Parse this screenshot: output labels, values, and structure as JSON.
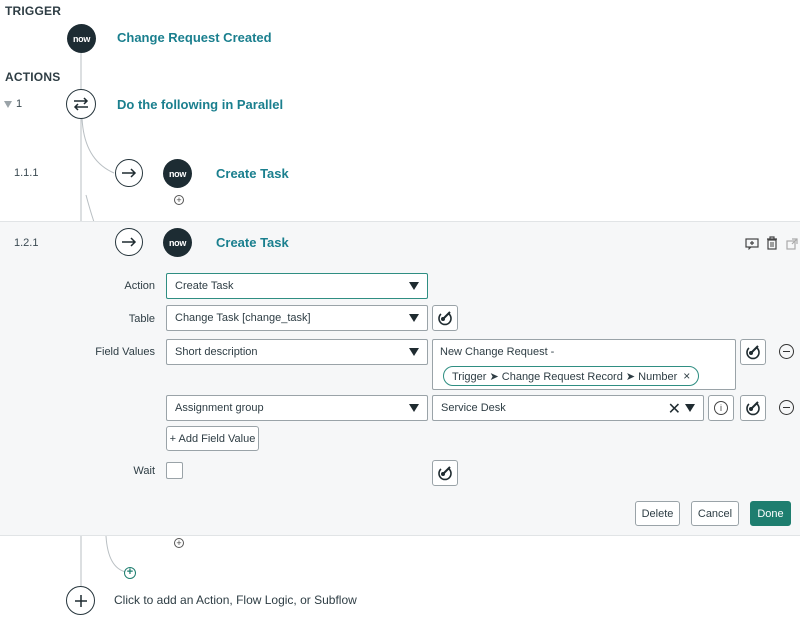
{
  "trigger": {
    "section_label": "TRIGGER",
    "badge": "now",
    "title": "Change Request Created"
  },
  "actions": {
    "section_label": "ACTIONS",
    "parallel": {
      "number": "1",
      "title": "Do the following in Parallel"
    },
    "step1": {
      "number": "1.1.1",
      "badge": "now",
      "title": "Create Task"
    },
    "step2": {
      "number": "1.2.1",
      "badge": "now",
      "title": "Create Task",
      "form": {
        "action_label": "Action",
        "action_value": "Create Task",
        "table_label": "Table",
        "table_value": "Change Task [change_task]",
        "field_values_label": "Field Values",
        "field1_name": "Short description",
        "field1_text": "New Change Request -",
        "field1_pill": "Trigger ➤ Change Request Record ➤ Number",
        "field2_name": "Assignment group",
        "field2_value": "Service Desk",
        "add_field_value": "+ Add Field Value",
        "wait_label": "Wait"
      },
      "buttons": {
        "delete": "Delete",
        "cancel": "Cancel",
        "done": "Done"
      }
    }
  },
  "footer": {
    "add_text": "Click to add an Action, Flow Logic, or Subflow"
  },
  "colors": {
    "accent": "#1a7f8e",
    "primary_button": "#1e7e6f",
    "badge": "#1d2c33"
  }
}
